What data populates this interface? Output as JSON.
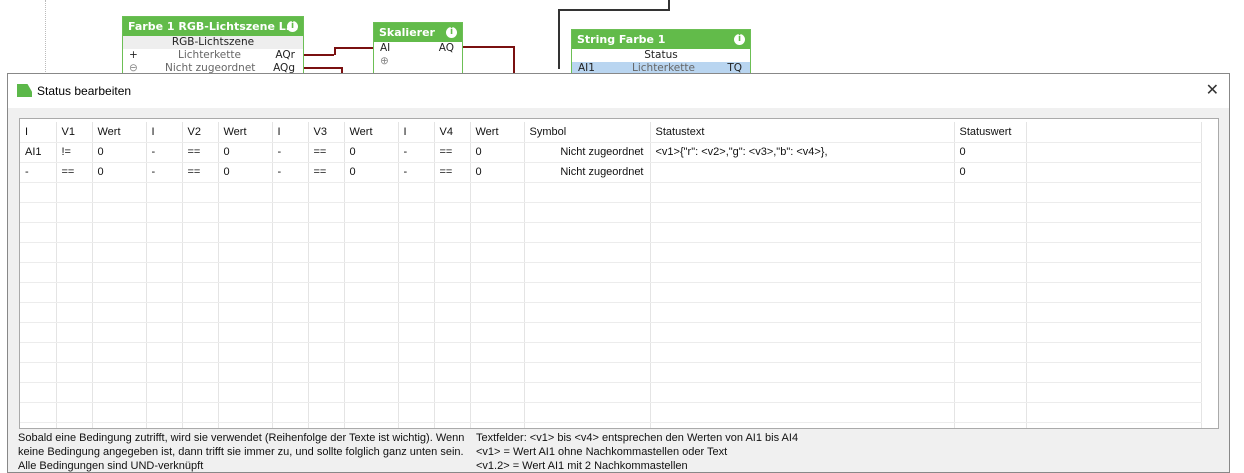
{
  "canvas": {
    "block1": {
      "title": "Farbe 1 RGB-Lichtszene L...",
      "subtitle": "RGB-Lichtszene",
      "rows": [
        {
          "left": "+",
          "label": "Lichterkette",
          "out": "AQr"
        },
        {
          "left": "⊖",
          "label": "Nicht zugeordnet",
          "out": "AQg"
        }
      ]
    },
    "block2": {
      "title": "Skalierer",
      "rows": [
        {
          "label": "AI",
          "out": "AQ"
        }
      ]
    },
    "block3": {
      "title": "String Farbe 1",
      "subtitle": "Status",
      "row": {
        "in": "AI1",
        "label": "Lichterkette",
        "out": "TQ"
      }
    }
  },
  "dialog": {
    "title": "Status bearbeiten",
    "close": "✕",
    "columns": [
      "I",
      "V1",
      "Wert",
      "I",
      "V2",
      "Wert",
      "I",
      "V3",
      "Wert",
      "I",
      "V4",
      "Wert",
      "Symbol",
      "Statustext",
      "Statuswert",
      ""
    ],
    "rows": [
      [
        "AI1",
        "!=",
        "0",
        "-",
        "==",
        "0",
        "-",
        "==",
        "0",
        "-",
        "==",
        "0",
        "Nicht zugeordnet",
        "<v1>{\"r\": <v2>,\"g\": <v3>,\"b\": <v4>},",
        "0",
        ""
      ],
      [
        "-",
        "==",
        "0",
        "-",
        "==",
        "0",
        "-",
        "==",
        "0",
        "-",
        "==",
        "0",
        "Nicht zugeordnet",
        "",
        "0",
        ""
      ]
    ],
    "help_left": [
      "Sobald eine Bedingung zutrifft, wird sie verwendet (Reihenfolge der Texte ist wichtig). Wenn",
      "keine Bedingung angegeben ist, dann trifft sie immer zu, und sollte folglich ganz unten sein.",
      "Alle Bedingungen sind UND-verknüpft"
    ],
    "help_right": [
      "Textfelder: <v1> bis <v4> entsprechen den Werten von AI1 bis AI4",
      "<v1> = Wert AI1 ohne Nachkommastellen oder Text",
      "<v1.2> = Wert AI1 mit 2 Nachkommastellen"
    ]
  }
}
